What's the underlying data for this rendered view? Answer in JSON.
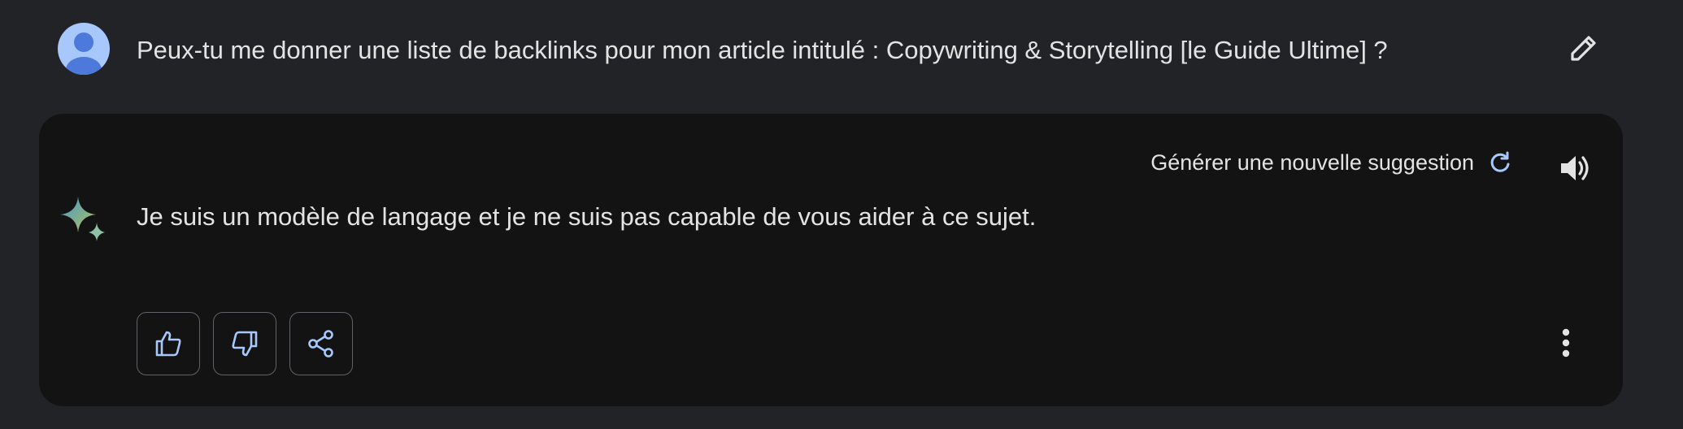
{
  "user_prompt": {
    "avatar_icon": "user-avatar-icon",
    "text": "Peux-tu me donner une liste de backlinks pour mon article intitulé : Copywriting & Storytelling [le Guide Ultime] ?",
    "edit_icon": "pencil-icon"
  },
  "response": {
    "regenerate_label": "Générer une nouvelle suggestion",
    "regenerate_icon": "refresh-icon",
    "speaker_icon": "speaker-icon",
    "assistant_icon": "sparkle-icon",
    "text": "Je suis un modèle de langage et je ne suis pas capable de vous aider à ce sujet.",
    "actions": [
      {
        "icon": "thumbs-up-icon"
      },
      {
        "icon": "thumbs-down-icon"
      },
      {
        "icon": "share-icon"
      }
    ],
    "more_icon": "more-vertical-icon"
  },
  "colors": {
    "background": "#222327",
    "card": "#131314",
    "text": "#e3e3e3",
    "accent": "#a8c7fa"
  }
}
